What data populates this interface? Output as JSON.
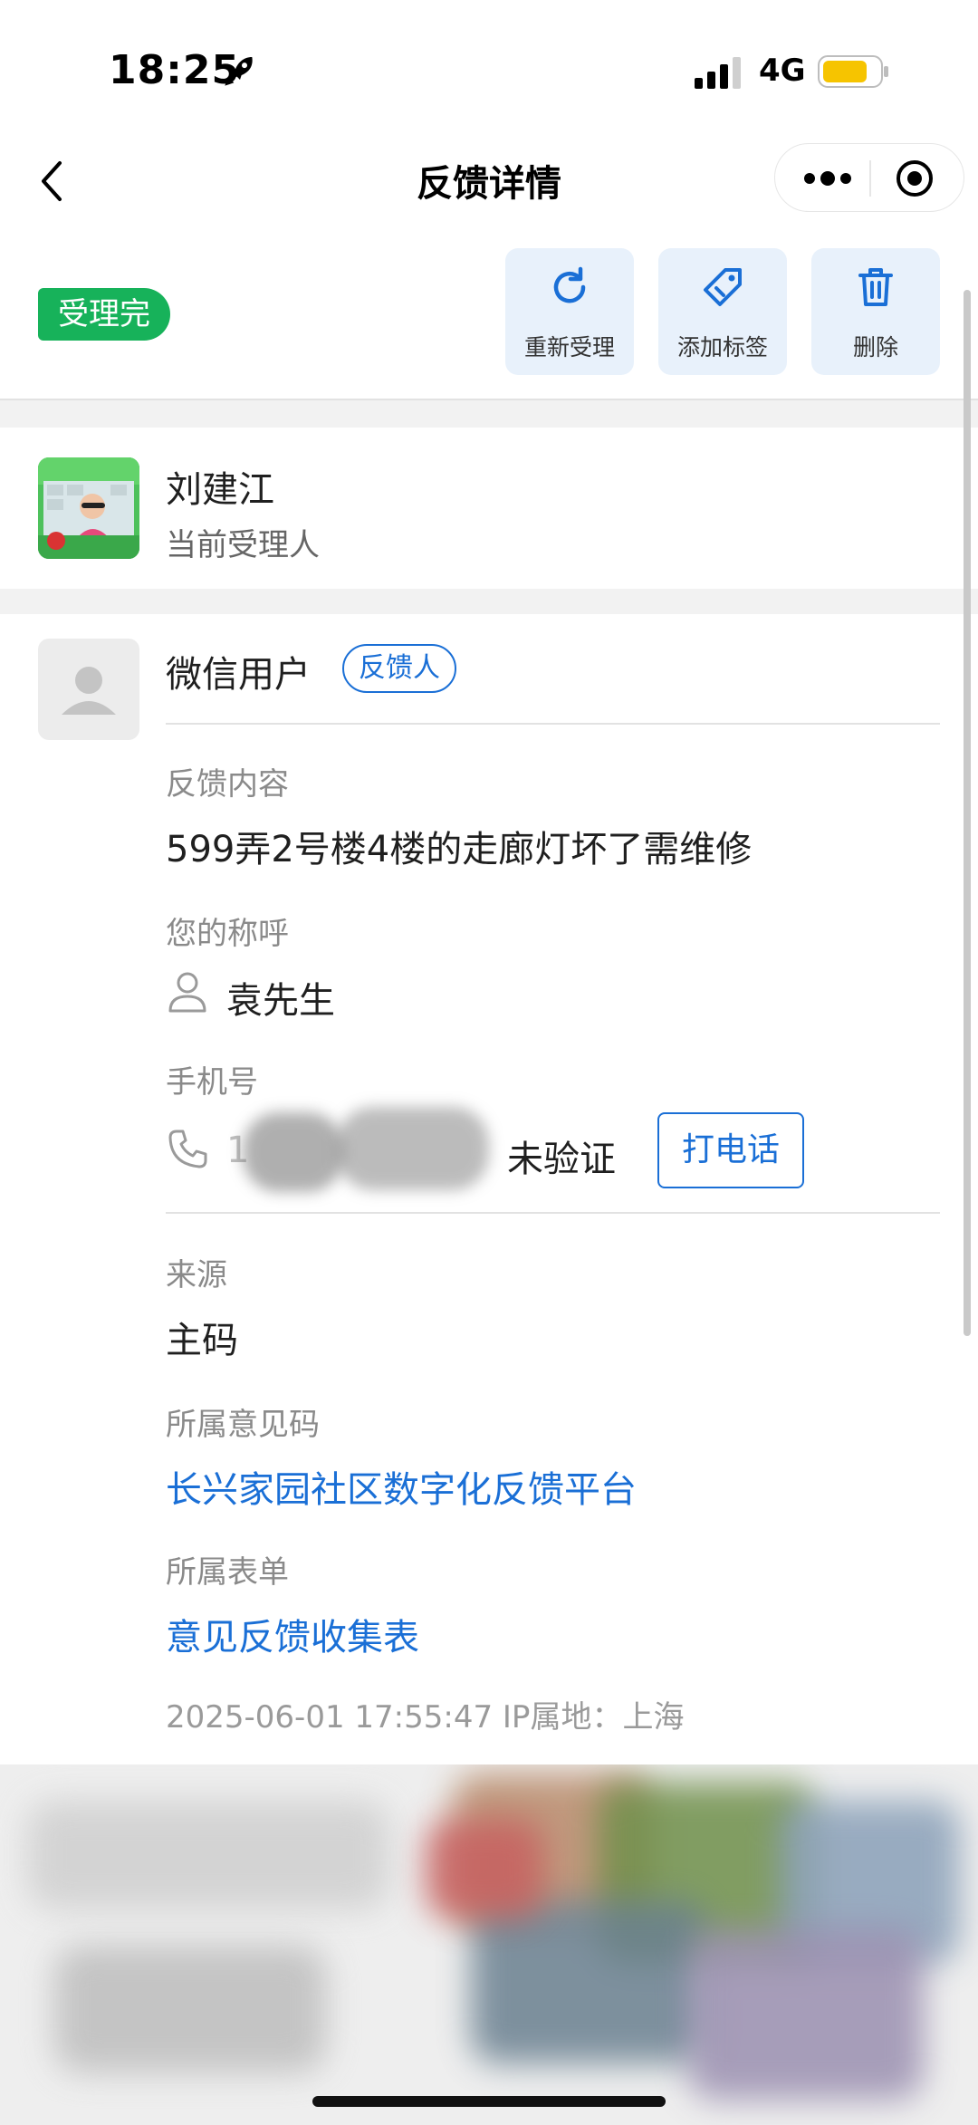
{
  "status_bar": {
    "time": "18:25",
    "network": "4G"
  },
  "nav": {
    "title": "反馈详情"
  },
  "status_badge": "受理完",
  "actions": [
    {
      "label": "重新受理",
      "icon": "refresh-icon"
    },
    {
      "label": "添加标签",
      "icon": "tag-icon"
    },
    {
      "label": "删除",
      "icon": "trash-icon"
    }
  ],
  "handler": {
    "name": "刘建江",
    "role": "当前受理人"
  },
  "feedback_user": {
    "name": "微信用户",
    "tag": "反馈人"
  },
  "fields": {
    "content_label": "反馈内容",
    "content_value": "599弄2号楼4楼的走廊灯坏了需维修",
    "title_label": "您的称呼",
    "title_value": "袁先生",
    "phone_label": "手机号",
    "phone_value": "1",
    "phone_status": "未验证",
    "call_button": "打电话",
    "source_label": "来源",
    "source_value": "主码",
    "code_label": "所属意见码",
    "code_value": "长兴家园社区数字化反馈平台",
    "form_label": "所属表单",
    "form_value": "意见反馈收集表"
  },
  "meta": "2025-06-01 17:55:47   IP属地：上海",
  "colors": {
    "accent": "#1a6fd6",
    "status_green": "#17b25a",
    "action_bg": "#e8f1fb"
  }
}
